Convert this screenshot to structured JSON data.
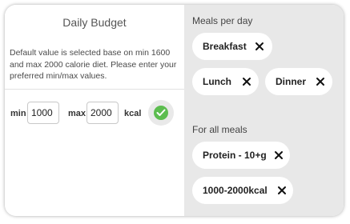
{
  "budget": {
    "title": "Daily Budget",
    "description": "Default value is selected base on min 1600 and max 2000 calorie diet. Please enter your preferred min/max values.",
    "min_label": "min",
    "min_value": "1000",
    "max_label": "max",
    "max_value": "2000",
    "unit_label": "kcal",
    "confirm_icon": "check-circle-icon"
  },
  "meals_per_day": {
    "title": "Meals per day",
    "chips": [
      {
        "label": "Breakfast",
        "icon": "close-icon"
      },
      {
        "label": "Lunch",
        "icon": "close-icon"
      },
      {
        "label": "Dinner",
        "icon": "close-icon"
      }
    ]
  },
  "for_all_meals": {
    "title": "For all meals",
    "chips": [
      {
        "label": "Protein - 10+g",
        "icon": "close-icon"
      },
      {
        "label": "1000-2000kcal",
        "icon": "close-icon"
      }
    ]
  },
  "colors": {
    "right_panel": "#e8e8e8",
    "confirm_green": "#5cbd4f",
    "chip_background": "#ffffff"
  }
}
